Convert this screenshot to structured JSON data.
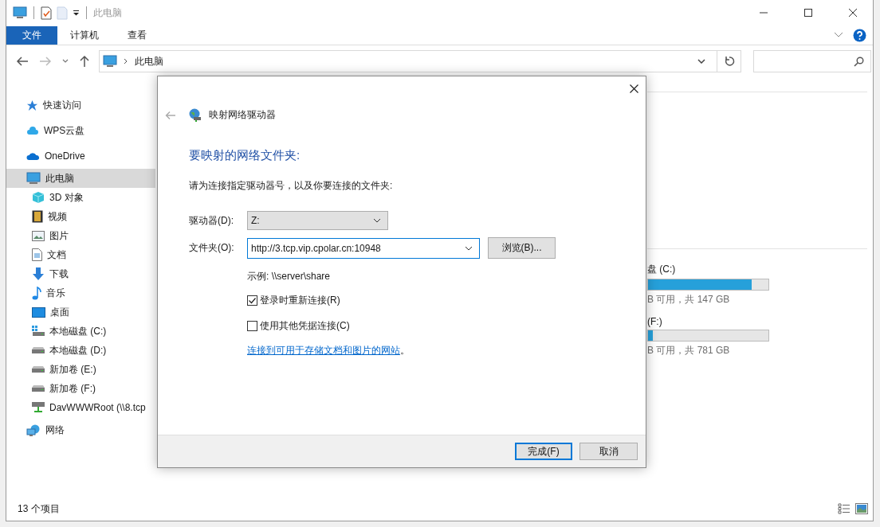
{
  "window": {
    "title": "此电脑"
  },
  "ribbon_tabs": [
    {
      "label": "文件",
      "selected": true
    },
    {
      "label": "计算机",
      "selected": false
    },
    {
      "label": "查看",
      "selected": false
    }
  ],
  "address_bar": {
    "path": "此电脑"
  },
  "sidebar": {
    "items": [
      {
        "label": "快速访问",
        "selected": false
      },
      {
        "label": "WPS云盘",
        "selected": false
      },
      {
        "label": "OneDrive",
        "selected": false
      },
      {
        "label": "此电脑",
        "selected": true,
        "children": [
          {
            "label": "3D 对象",
            "selected": false
          },
          {
            "label": "视频",
            "selected": false
          },
          {
            "label": "图片",
            "selected": false
          },
          {
            "label": "文档",
            "selected": false
          },
          {
            "label": "下载",
            "selected": false
          },
          {
            "label": "音乐",
            "selected": false
          },
          {
            "label": "桌面",
            "selected": false
          },
          {
            "label": "本地磁盘 (C:)",
            "selected": false
          },
          {
            "label": "本地磁盘 (D:)",
            "selected": false
          },
          {
            "label": "新加卷 (E:)",
            "selected": false
          },
          {
            "label": "新加卷 (F:)",
            "selected": false
          },
          {
            "label": "DavWWWRoot (\\\\8.tcp",
            "selected": false
          }
        ]
      },
      {
        "label": "网络",
        "selected": false
      }
    ]
  },
  "drives": [
    {
      "label": "盘 (C:)",
      "level": 0.86,
      "info": "B 可用，共 147 GB"
    },
    {
      "label": "(F:)",
      "level": 0.04,
      "info": "B 可用，共 781 GB"
    }
  ],
  "status_bar": {
    "item_count": "13 个项目"
  },
  "dialog": {
    "title": "映射网络驱动器",
    "heading": "要映射的网络文件夹:",
    "instruction": "请为连接指定驱动器号，以及你要连接的文件夹:",
    "drive": {
      "label": "驱动器(D):",
      "value": "Z:"
    },
    "folder": {
      "label": "文件夹(O):",
      "value": "http://3.tcp.vip.cpolar.cn:10948"
    },
    "browse_button": "浏览(B)...",
    "example": "示例: \\\\server\\share",
    "checkboxes": [
      {
        "label": "登录时重新连接(R)",
        "checked": true
      },
      {
        "label": "使用其他凭据连接(C)",
        "checked": false
      }
    ],
    "link": "连接到可用于存储文档和图片的网站",
    "link_suffix": "。",
    "buttons": [
      {
        "label": "完成(F)",
        "default": true
      },
      {
        "label": "取消",
        "default": false
      }
    ]
  }
}
